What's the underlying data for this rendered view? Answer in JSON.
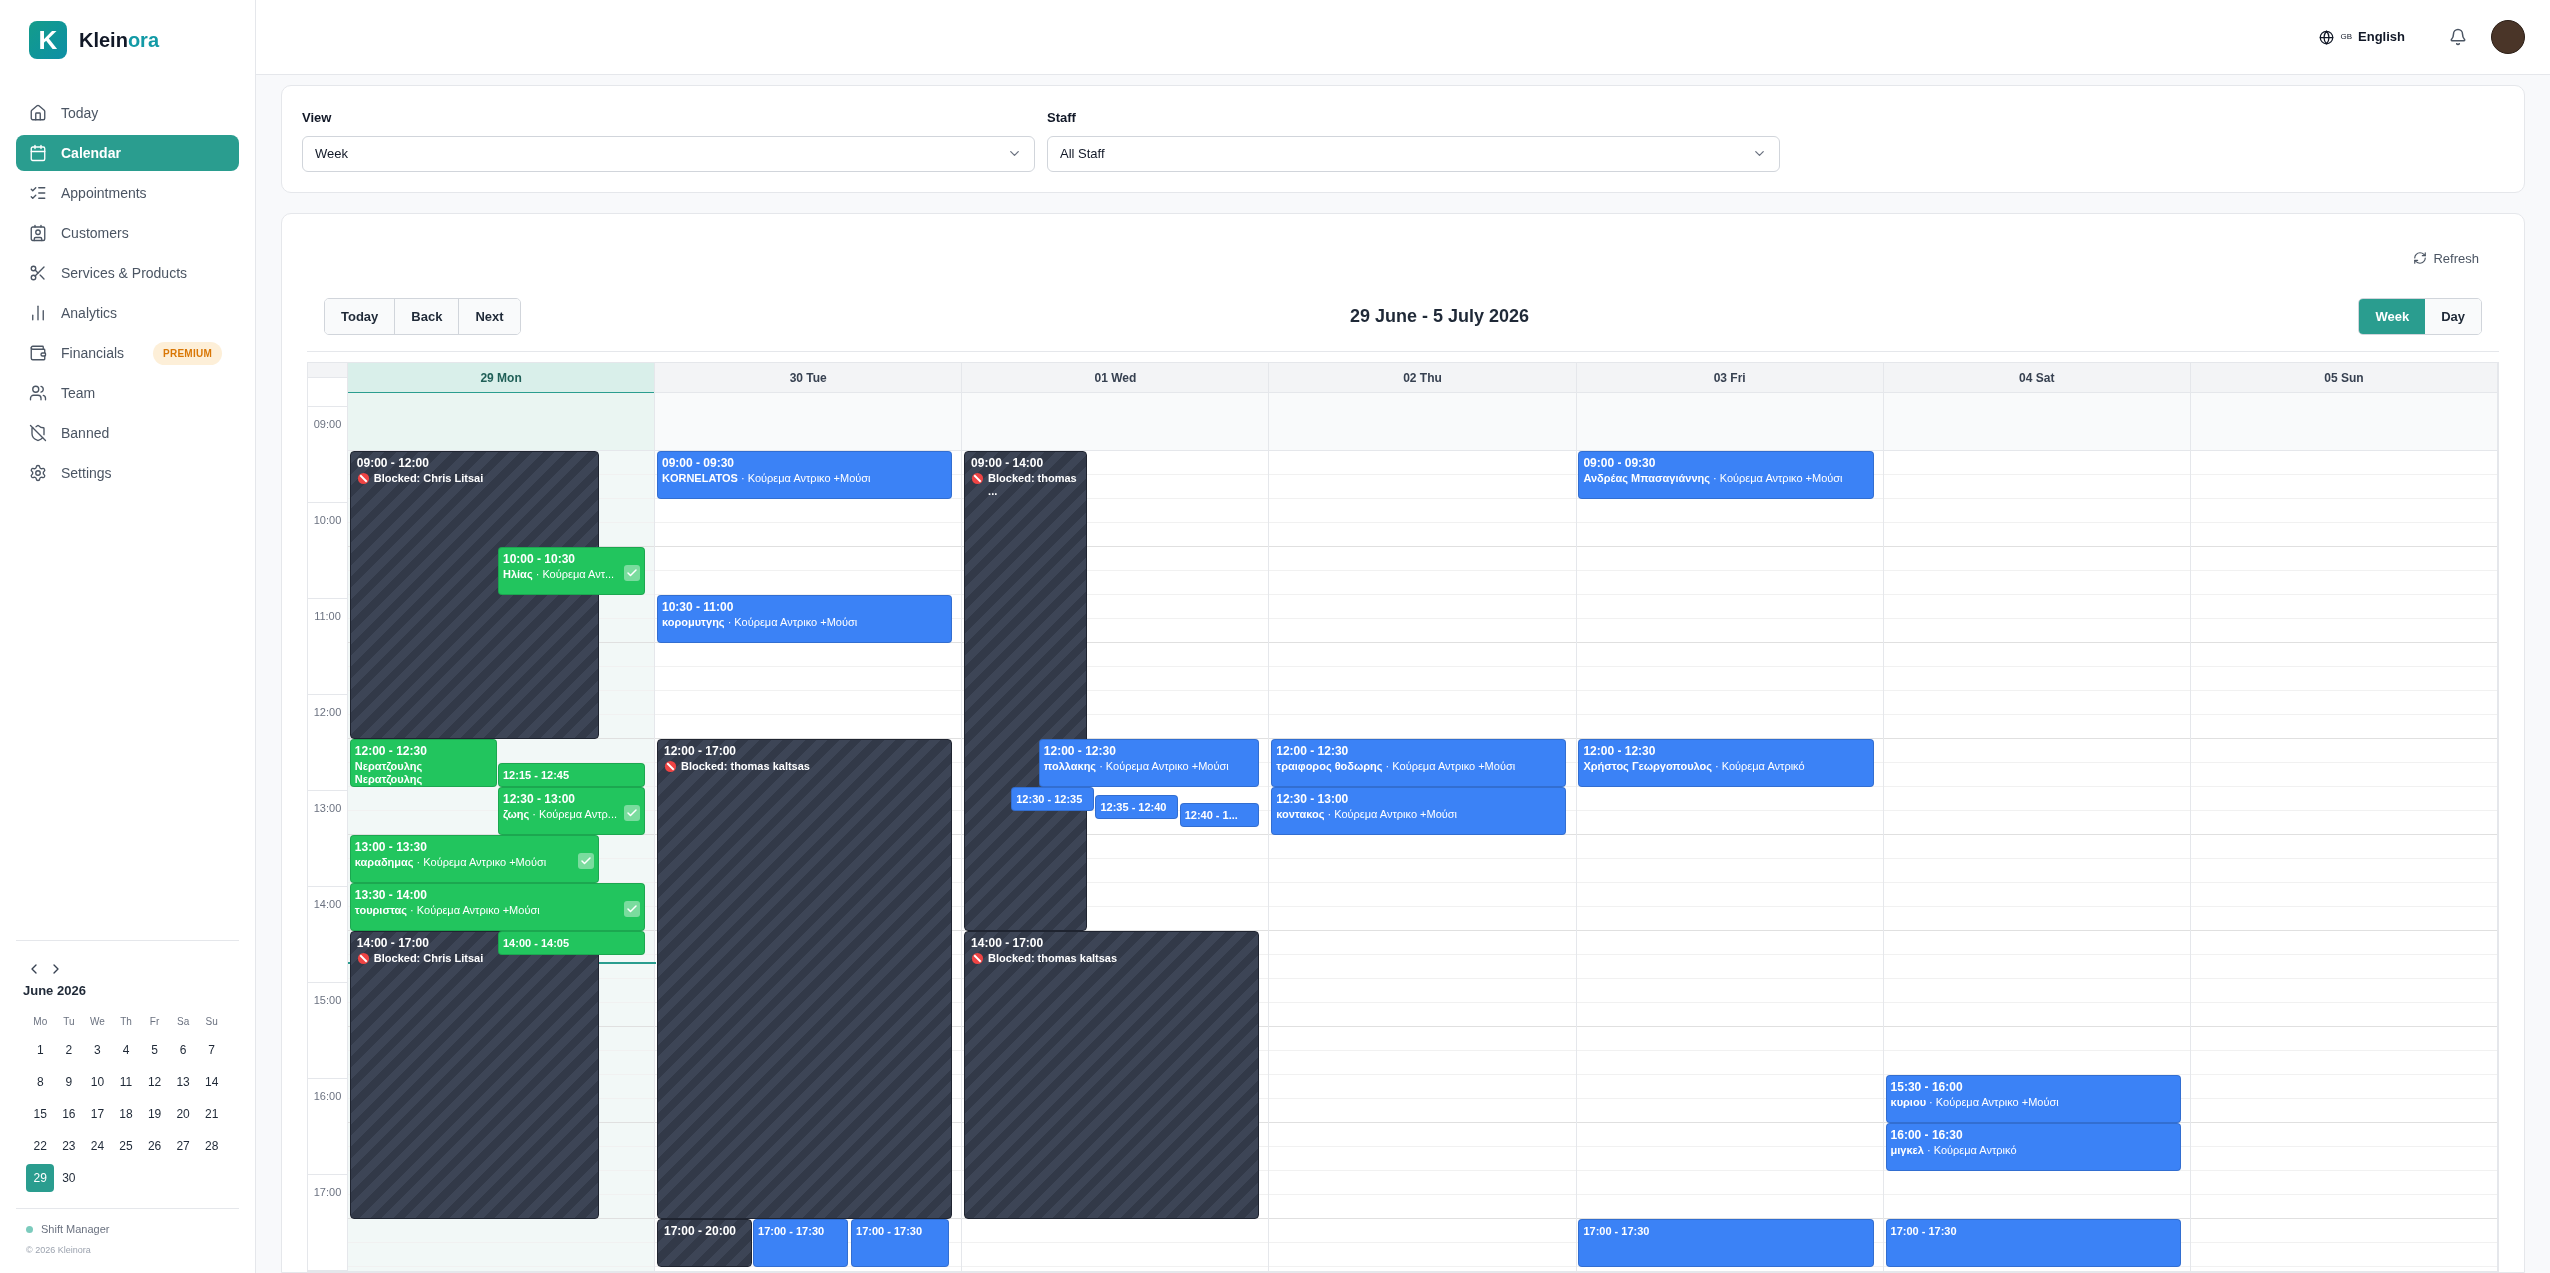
{
  "brand": {
    "logo_letter": "K",
    "name_start": "Klein",
    "name_end": "ora"
  },
  "sidebar": {
    "items": [
      {
        "label": "Today",
        "selected": false
      },
      {
        "label": "Calendar",
        "selected": true
      },
      {
        "label": "Appointments",
        "selected": false
      },
      {
        "label": "Customers",
        "selected": false
      },
      {
        "label": "Services & Products",
        "selected": false
      },
      {
        "label": "Analytics",
        "selected": false
      },
      {
        "label": "Financials",
        "selected": false,
        "badge": "PREMIUM"
      },
      {
        "label": "Team",
        "selected": false
      },
      {
        "label": "Banned",
        "selected": false
      },
      {
        "label": "Settings",
        "selected": false
      }
    ],
    "mini_calendar": {
      "month": "June 2026",
      "weekdays": [
        "Mo",
        "Tu",
        "We",
        "Th",
        "Fr",
        "Sa",
        "Su"
      ],
      "days": [
        {
          "label": "1",
          "selected": false
        },
        {
          "label": "2",
          "selected": false
        },
        {
          "label": "3",
          "selected": false
        },
        {
          "label": "4",
          "selected": false
        },
        {
          "label": "5",
          "selected": false
        },
        {
          "label": "6",
          "selected": false
        },
        {
          "label": "7",
          "selected": false
        },
        {
          "label": "8",
          "selected": false
        },
        {
          "label": "9",
          "selected": false
        },
        {
          "label": "10",
          "selected": false
        },
        {
          "label": "11",
          "selected": false
        },
        {
          "label": "12",
          "selected": false
        },
        {
          "label": "13",
          "selected": false
        },
        {
          "label": "14",
          "selected": false
        },
        {
          "label": "15",
          "selected": false
        },
        {
          "label": "16",
          "selected": false
        },
        {
          "label": "17",
          "selected": false
        },
        {
          "label": "18",
          "selected": false
        },
        {
          "label": "19",
          "selected": false
        },
        {
          "label": "20",
          "selected": false
        },
        {
          "label": "21",
          "selected": false
        },
        {
          "label": "22",
          "selected": false
        },
        {
          "label": "23",
          "selected": false
        },
        {
          "label": "24",
          "selected": false
        },
        {
          "label": "25",
          "selected": false
        },
        {
          "label": "26",
          "selected": false
        },
        {
          "label": "27",
          "selected": false
        },
        {
          "label": "28",
          "selected": false
        },
        {
          "label": "29",
          "selected": true
        },
        {
          "label": "30",
          "selected": false
        }
      ]
    },
    "footer": {
      "role": "Shift Manager",
      "copyright": "© 2026 Kleinora"
    }
  },
  "top_bar": {
    "language_code": "GB",
    "language": "English"
  },
  "filters": [
    {
      "label": "View",
      "value": "Week"
    },
    {
      "label": "Staff",
      "value": "All Staff"
    }
  ],
  "calendar": {
    "refresh": "Refresh",
    "nav_buttons": [
      "Today",
      "Back",
      "Next"
    ],
    "title": "29 June - 5 July 2026",
    "view_toggle": [
      {
        "label": "Week",
        "selected": true
      },
      {
        "label": "Day",
        "selected": false
      }
    ],
    "hours": [
      "09:00",
      "10:00",
      "11:00",
      "12:00",
      "13:00",
      "14:00",
      "15:00",
      "16:00",
      "17:00"
    ],
    "days": [
      {
        "label": "29 Mon",
        "today": true,
        "events": [
          {
            "kind": "blocked",
            "time": "09:00 - 12:00",
            "label": "Blocked: Chris Litsai"
          },
          {
            "kind": "appointment",
            "time": "10:00 - 10:30",
            "details": "**Ηλίας** · Κούρεμα Αντ...",
            "color": "#22c55e",
            "checked": true
          },
          {
            "kind": "appointment",
            "time": "12:00 - 12:30",
            "details": "**Νερατζουλης Νερατζουλης**",
            "color": "#22c55e",
            "checked": false
          },
          {
            "kind": "appointment",
            "time": "12:15 - 12:45",
            "color": "#22c55e",
            "checked": false
          },
          {
            "kind": "appointment",
            "time": "12:30 - 13:00",
            "details": "**ζωης** · Κούρεμα Αντρ...",
            "color": "#22c55e",
            "checked": true
          },
          {
            "kind": "appointment",
            "time": "13:00 - 13:30",
            "details": "**καραδημας** · Κούρεμα Αντρικο +Μούσι",
            "color": "#22c55e",
            "checked": true
          },
          {
            "kind": "appointment",
            "time": "13:30 - 14:00",
            "details": "**τουριστας** · Κούρεμα Αντρικο +Μούσι",
            "color": "#22c55e",
            "checked": true
          },
          {
            "kind": "blocked",
            "time": "14:00 - 17:00",
            "label": "Blocked: Chris Litsai"
          },
          {
            "kind": "appointment",
            "time": "14:00 - 14:05",
            "color": "#22c55e",
            "checked": false
          }
        ]
      },
      {
        "label": "30 Tue",
        "today": false,
        "events": [
          {
            "kind": "appointment",
            "time": "09:00 - 09:30",
            "details": "**KORNELATOS** · Κούρεμα Αντρικο +Μούσι",
            "color": "#3b82f6",
            "checked": false
          },
          {
            "kind": "appointment",
            "time": "10:30 - 11:00",
            "details": "**κορομυτγης** · Κούρεμα Αντρικο +Μούσι",
            "color": "#3b82f6",
            "checked": false
          },
          {
            "kind": "blocked",
            "time": "12:00 - 17:00",
            "label": "Blocked: thomas kaltsas"
          },
          {
            "kind": "blocked",
            "time": "17:00 - 20:00"
          },
          {
            "kind": "appointment",
            "time": "17:00 - 17:30",
            "color": "#3b82f6",
            "checked": false
          },
          {
            "kind": "appointment",
            "time": "17:00 - 17:30",
            "color": "#3b82f6",
            "checked": false
          }
        ]
      },
      {
        "label": "01 Wed",
        "today": false,
        "events": [
          {
            "kind": "blocked",
            "time": "09:00 - 14:00",
            "label": "Blocked: thomas ..."
          },
          {
            "kind": "appointment",
            "time": "12:00 - 12:30",
            "details": "**πολλακης** · Κούρεμα Αντρικο +Μούσι",
            "color": "#3b82f6",
            "checked": false
          },
          {
            "kind": "appointment",
            "time": "12:30 - 12:35",
            "color": "#3b82f6",
            "checked": false
          },
          {
            "kind": "appointment",
            "time": "12:35 - 12:40",
            "color": "#3b82f6",
            "checked": false
          },
          {
            "kind": "appointment",
            "time": "12:40 - 1...",
            "color": "#3b82f6",
            "checked": false
          },
          {
            "kind": "blocked",
            "time": "14:00 - 17:00",
            "label": "Blocked: thomas kaltsas"
          }
        ]
      },
      {
        "label": "02 Thu",
        "today": false,
        "events": [
          {
            "kind": "appointment",
            "time": "12:00 - 12:30",
            "details": "**τραιφορος θοδωρης** · Κούρεμα Αντρικο +Μούσι",
            "color": "#3b82f6",
            "checked": false
          },
          {
            "kind": "appointment",
            "time": "12:30 - 13:00",
            "details": "**κοντακος** · Κούρεμα Αντρικο +Μούσι",
            "color": "#3b82f6",
            "checked": false
          }
        ]
      },
      {
        "label": "03 Fri",
        "today": false,
        "events": [
          {
            "kind": "appointment",
            "time": "09:00 - 09:30",
            "details": "**Ανδρέας Μπασαγιάννης** · Κούρεμα Αντρικο +Μούσι",
            "color": "#3b82f6",
            "checked": false
          },
          {
            "kind": "appointment",
            "time": "12:00 - 12:30",
            "details": "**Χρήστος Γεωργοπουλος** · Κούρεμα Αντρικό",
            "color": "#3b82f6",
            "checked": false
          },
          {
            "kind": "appointment",
            "time": "17:00 - 17:30",
            "color": "#3b82f6",
            "checked": false
          }
        ]
      },
      {
        "label": "04 Sat",
        "today": false,
        "events": [
          {
            "kind": "appointment",
            "time": "15:30 - 16:00",
            "details": "**κυριου** · Κούρεμα Αντρικο +Μούσι",
            "color": "#3b82f6",
            "checked": false
          },
          {
            "kind": "appointment",
            "time": "16:00 - 16:30",
            "details": "**μιγκελ** · Κούρεμα Αντρικό",
            "color": "#3b82f6",
            "checked": false
          },
          {
            "kind": "appointment",
            "time": "17:00 - 17:30",
            "color": "#3b82f6",
            "checked": false
          }
        ]
      },
      {
        "label": "05 Sun",
        "today": false
      }
    ]
  }
}
